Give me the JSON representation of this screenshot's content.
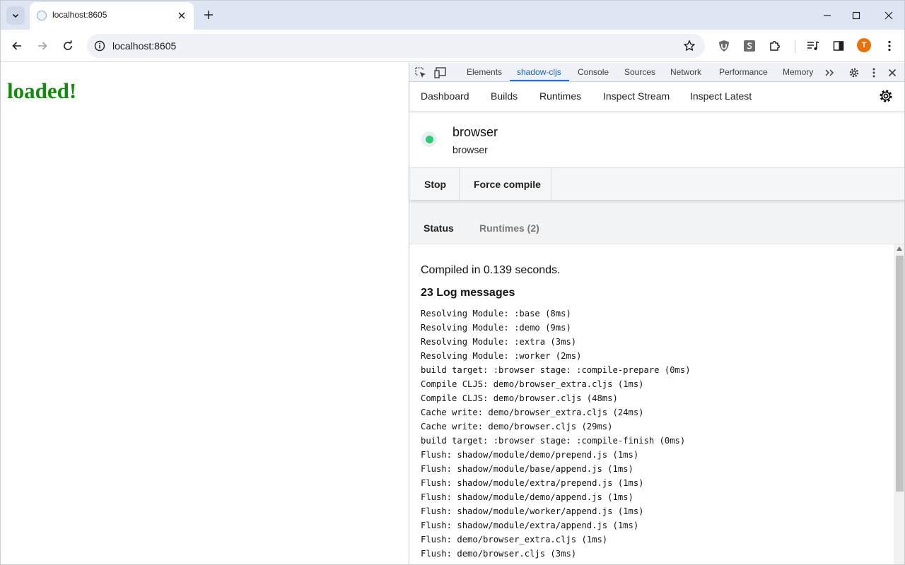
{
  "browser": {
    "tab_title": "localhost:8605",
    "url": "localhost:8605",
    "avatar_initial": "T",
    "accent_color": "#e8710a"
  },
  "page": {
    "heading": "loaded!",
    "heading_color": "#138a0e"
  },
  "devtools": {
    "tabs": [
      "Elements",
      "shadow-cljs",
      "Console",
      "Sources",
      "Network",
      "Performance",
      "Memory"
    ],
    "active_tab": "shadow-cljs"
  },
  "shadow_cljs": {
    "nav": [
      "Dashboard",
      "Builds",
      "Runtimes",
      "Inspect Stream",
      "Inspect Latest"
    ],
    "build": {
      "name": "browser",
      "target": "browser",
      "status_color": "#2fc97a"
    },
    "actions": {
      "stop_label": "Stop",
      "force_compile_label": "Force compile"
    },
    "subtabs": {
      "status_label": "Status",
      "runtimes_label": "Runtimes (2)",
      "active": "Status"
    },
    "compiled_text": "Compiled in 0.139 seconds.",
    "log_count_text": "23 Log messages",
    "log_messages": [
      "Resolving Module: :base (8ms)",
      "Resolving Module: :demo (9ms)",
      "Resolving Module: :extra (3ms)",
      "Resolving Module: :worker (2ms)",
      "build target: :browser stage: :compile-prepare (0ms)",
      "Compile CLJS: demo/browser_extra.cljs (1ms)",
      "Compile CLJS: demo/browser.cljs (48ms)",
      "Cache write: demo/browser_extra.cljs (24ms)",
      "Cache write: demo/browser.cljs (29ms)",
      "build target: :browser stage: :compile-finish (0ms)",
      "Flush: shadow/module/demo/prepend.js (1ms)",
      "Flush: shadow/module/base/append.js (1ms)",
      "Flush: shadow/module/extra/prepend.js (1ms)",
      "Flush: shadow/module/demo/append.js (1ms)",
      "Flush: shadow/module/worker/append.js (1ms)",
      "Flush: shadow/module/extra/append.js (1ms)",
      "Flush: demo/browser_extra.cljs (1ms)",
      "Flush: demo/browser.cljs (3ms)"
    ]
  }
}
